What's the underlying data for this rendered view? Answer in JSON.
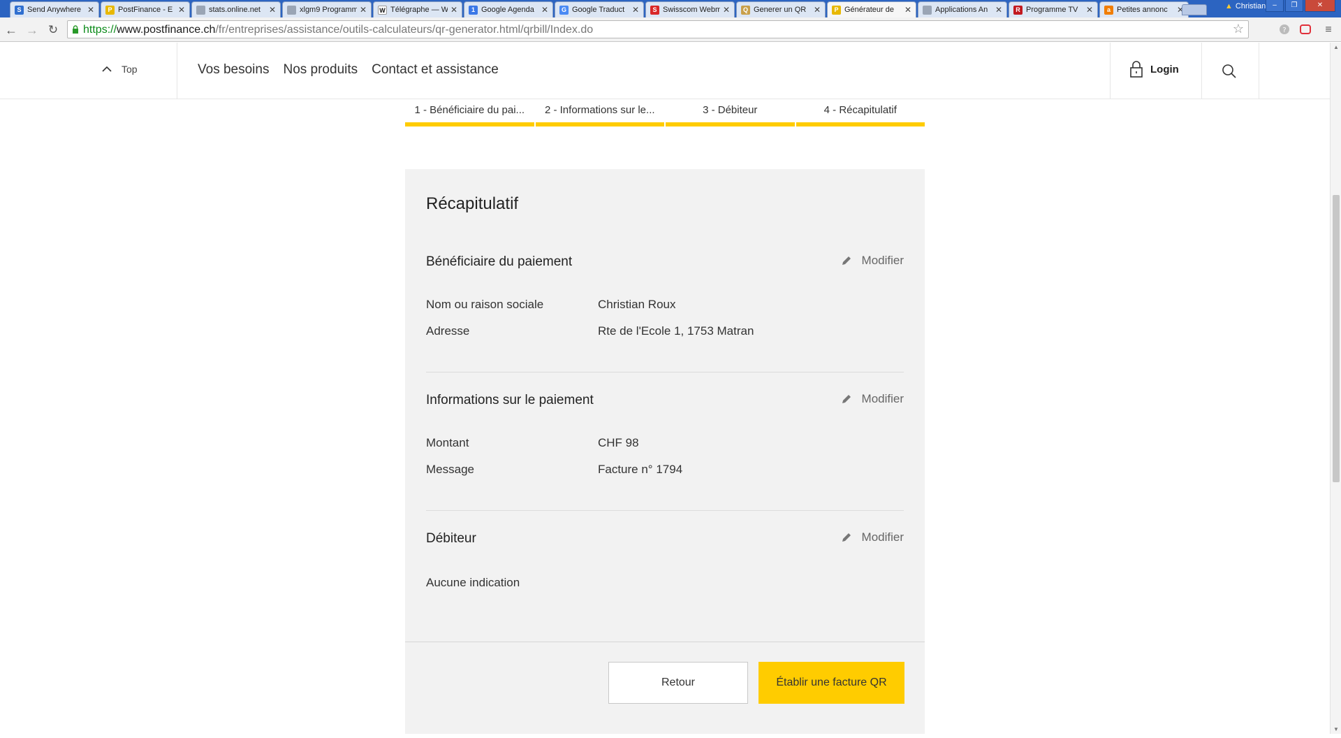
{
  "browser": {
    "tabs": [
      {
        "title": "Send Anywhere",
        "fav_color": "#2f6fd0",
        "fav_text": "S"
      },
      {
        "title": "PostFinance - E",
        "fav_color": "#e8b800",
        "fav_text": "P"
      },
      {
        "title": "stats.online.net",
        "fav_color": "#9aa5b5",
        "fav_text": ""
      },
      {
        "title": "xlgm9 Programm",
        "fav_color": "#9aa5b5",
        "fav_text": ""
      },
      {
        "title": "Télégraphe — W",
        "fav_color": "#ffffff",
        "fav_text": "W"
      },
      {
        "title": "Google Agenda",
        "fav_color": "#3b78e7",
        "fav_text": "1"
      },
      {
        "title": "Google Traduct",
        "fav_color": "#4a8af4",
        "fav_text": "G"
      },
      {
        "title": "Swisscom Webm",
        "fav_color": "#d92828",
        "fav_text": "S"
      },
      {
        "title": "Generer un QR",
        "fav_color": "#c9a04a",
        "fav_text": "Q"
      },
      {
        "title": "Générateur de",
        "fav_color": "#e8b800",
        "fav_text": "P"
      },
      {
        "title": "Applications An",
        "fav_color": "#9aa5b5",
        "fav_text": ""
      },
      {
        "title": "Programme TV",
        "fav_color": "#c2191f",
        "fav_text": "R"
      },
      {
        "title": "Petites annonc",
        "fav_color": "#f07d00",
        "fav_text": "a"
      }
    ],
    "active_tab_index": 9,
    "user_name": "Christian",
    "url_scheme": "https://",
    "url_host": "www.postfinance.ch",
    "url_path": "/fr/entreprises/assistance/outils-calculateurs/qr-generator.html/qrbill/Index.do"
  },
  "header": {
    "top_label": "Top",
    "nav": [
      "Vos besoins",
      "Nos produits",
      "Contact et assistance"
    ],
    "login_label": "Login"
  },
  "steps": [
    "1 - Bénéficiaire du pai...",
    "2 - Informations sur le...",
    "3 - Débiteur",
    "4 - Récapitulatif"
  ],
  "summary": {
    "title": "Récapitulatif",
    "modify_label": "Modifier",
    "beneficiary": {
      "title": "Bénéficiaire du paiement",
      "name_label": "Nom ou raison sociale",
      "name_value": "Christian Roux",
      "address_label": "Adresse",
      "address_value": "Rte de l'Ecole 1, 1753 Matran"
    },
    "payment": {
      "title": "Informations sur le paiement",
      "amount_label": "Montant",
      "amount_value": "CHF 98",
      "message_label": "Message",
      "message_value": "Facture n° 1794"
    },
    "debtor": {
      "title": "Débiteur",
      "value": "Aucune indication"
    },
    "back_button": "Retour",
    "create_button": "Établir une facture QR"
  },
  "colors": {
    "brand_yellow": "#ffcc00",
    "card_bg": "#f2f2f2",
    "tabbar_blue": "#2c64c1"
  }
}
